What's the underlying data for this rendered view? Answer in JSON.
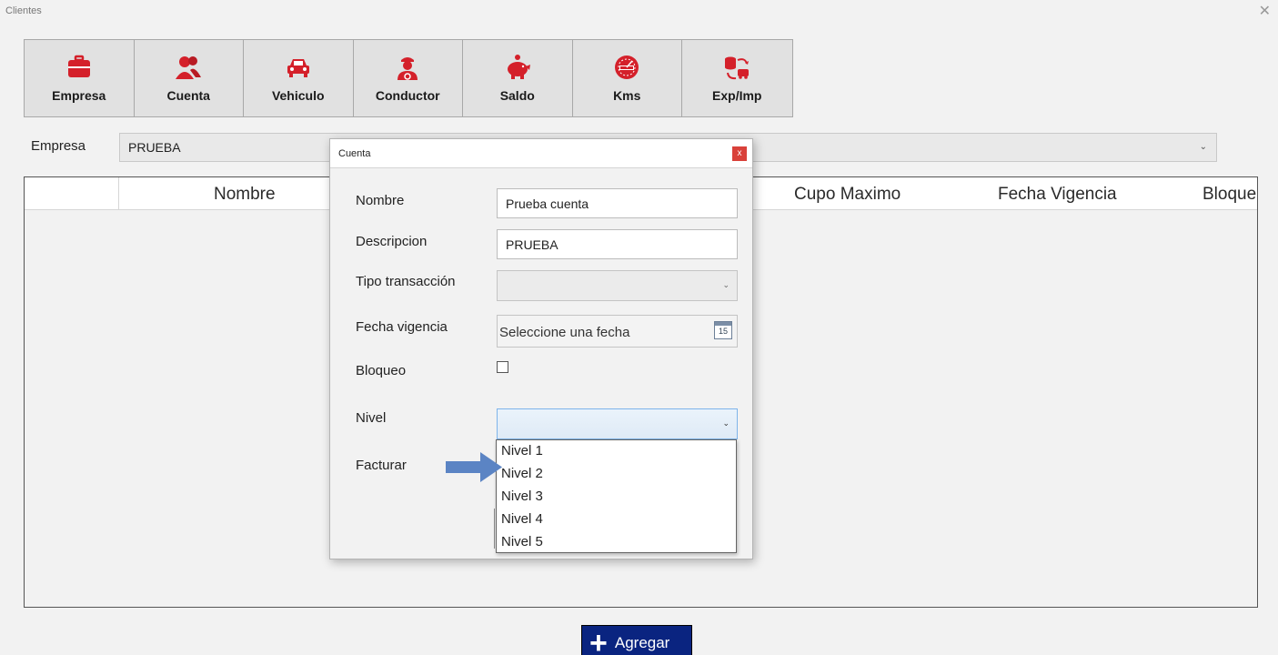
{
  "window": {
    "title": "Clientes",
    "close_glyph": "✕"
  },
  "toolbar": [
    {
      "label": "Empresa",
      "icon": "briefcase-icon"
    },
    {
      "label": "Cuenta",
      "icon": "users-icon"
    },
    {
      "label": "Vehiculo",
      "icon": "car-icon"
    },
    {
      "label": "Conductor",
      "icon": "driver-icon"
    },
    {
      "label": "Saldo",
      "icon": "piggy-bank-icon"
    },
    {
      "label": "Kms",
      "icon": "odometer-icon"
    },
    {
      "label": "Exp/Imp",
      "icon": "export-import-icon"
    }
  ],
  "empresa": {
    "label": "Empresa",
    "selected": "PRUEBA",
    "chevron": "⌄"
  },
  "grid": {
    "columns": [
      "Nombre",
      "Cupo Maximo",
      "Fecha Vigencia",
      "Bloque"
    ]
  },
  "dialog": {
    "title": "Cuenta",
    "close_glyph": "x",
    "fields": {
      "nombre": {
        "label": "Nombre",
        "value": "Prueba cuenta"
      },
      "descripcion": {
        "label": "Descripcion",
        "value": "PRUEBA"
      },
      "tipo": {
        "label": "Tipo transacción",
        "value": ""
      },
      "fecha": {
        "label": "Fecha vigencia",
        "placeholder": "Seleccione una fecha",
        "cal_day": "15"
      },
      "bloqueo": {
        "label": "Bloqueo",
        "checked": false
      },
      "nivel": {
        "label": "Nivel",
        "value": "",
        "options": [
          "Nivel 1",
          "Nivel 2",
          "Nivel 3",
          "Nivel 4",
          "Nivel 5"
        ]
      },
      "facturar": {
        "label": "Facturar"
      }
    }
  },
  "add_button": {
    "label": "Agregar",
    "plus": "+"
  },
  "colors": {
    "accent_red": "#d4202a",
    "add_button": "#0a2480",
    "arrow": "#5b84c4"
  }
}
